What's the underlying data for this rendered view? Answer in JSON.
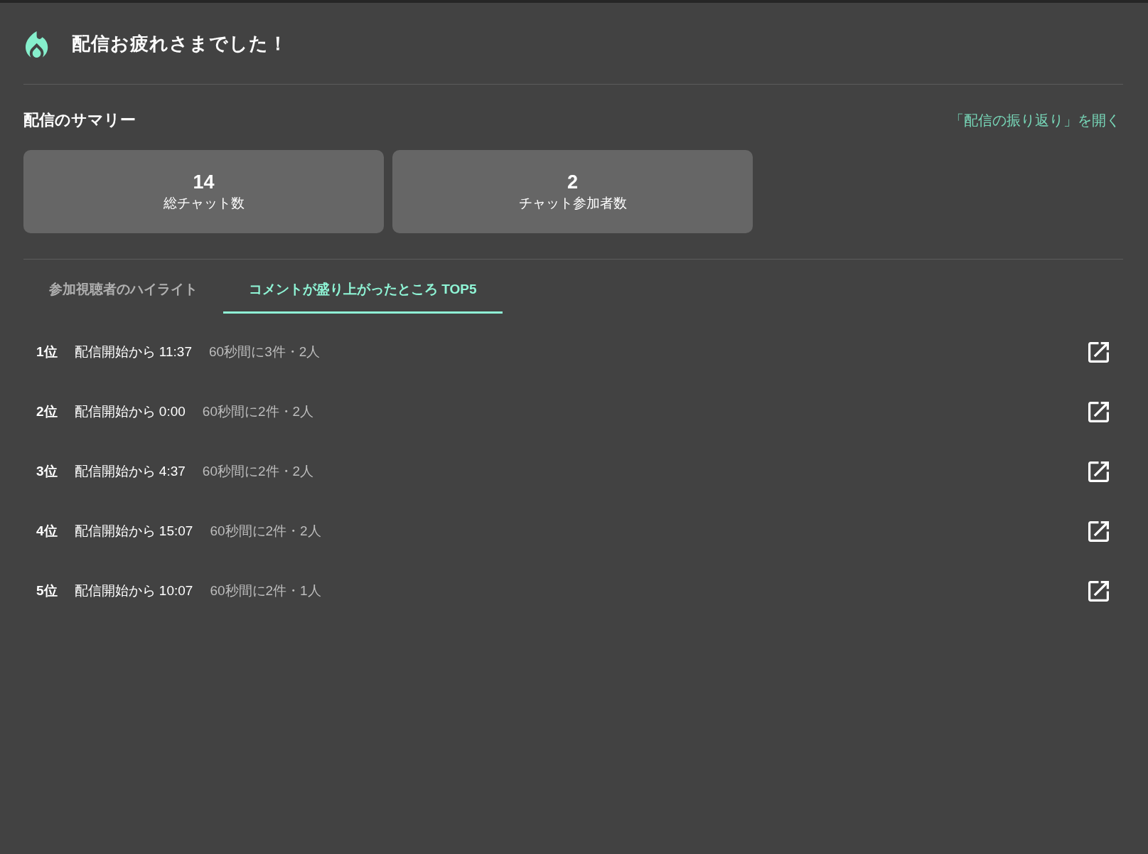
{
  "header": {
    "title": "配信お疲れさまでした！"
  },
  "summary": {
    "heading": "配信のサマリー",
    "link": "「配信の振り返り」を開く",
    "stats": [
      {
        "value": "14",
        "label": "総チャット数"
      },
      {
        "value": "2",
        "label": "チャット参加者数"
      }
    ]
  },
  "tabs": [
    {
      "label": "参加視聴者のハイライト",
      "selected": false
    },
    {
      "label": "コメントが盛り上がったところ TOP5",
      "selected": true
    }
  ],
  "rankings": [
    {
      "rank": "1位",
      "time": "配信開始から 11:37",
      "count": "60秒間に3件・2人"
    },
    {
      "rank": "2位",
      "time": "配信開始から 0:00",
      "count": "60秒間に2件・2人"
    },
    {
      "rank": "3位",
      "time": "配信開始から 4:37",
      "count": "60秒間に2件・2人"
    },
    {
      "rank": "4位",
      "time": "配信開始から 15:07",
      "count": "60秒間に2件・2人"
    },
    {
      "rank": "5位",
      "time": "配信開始から 10:07",
      "count": "60秒間に2件・1人"
    }
  ]
}
